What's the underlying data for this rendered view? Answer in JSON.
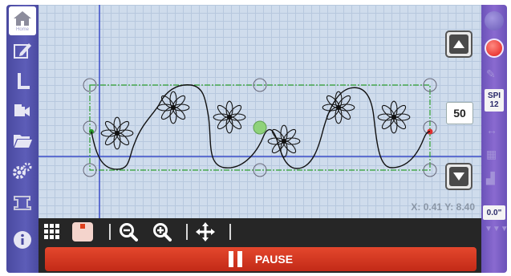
{
  "sidebar_left": {
    "home_label": "Home",
    "icons": [
      "home-icon",
      "edit-icon",
      "ruler-icon",
      "camera-icon",
      "folder-icon",
      "settings-icon",
      "sewing-machine-icon",
      "info-icon"
    ]
  },
  "canvas": {
    "speed_value": "50",
    "coordinates": "X: 0.41 Y: 8.40",
    "grid_color": "#b7c8de",
    "background_color": "#cfdcec"
  },
  "sidebar_right": {
    "spi_label": "SPI",
    "spi_value": "12",
    "angle_value": "0.0\""
  },
  "toolbar": {
    "icons": [
      "grid-icon",
      "needle-position-icon",
      "zoom-out-icon",
      "zoom-in-icon",
      "move-icon"
    ]
  },
  "pause": {
    "label": "PAUSE",
    "color": "#d23520"
  }
}
